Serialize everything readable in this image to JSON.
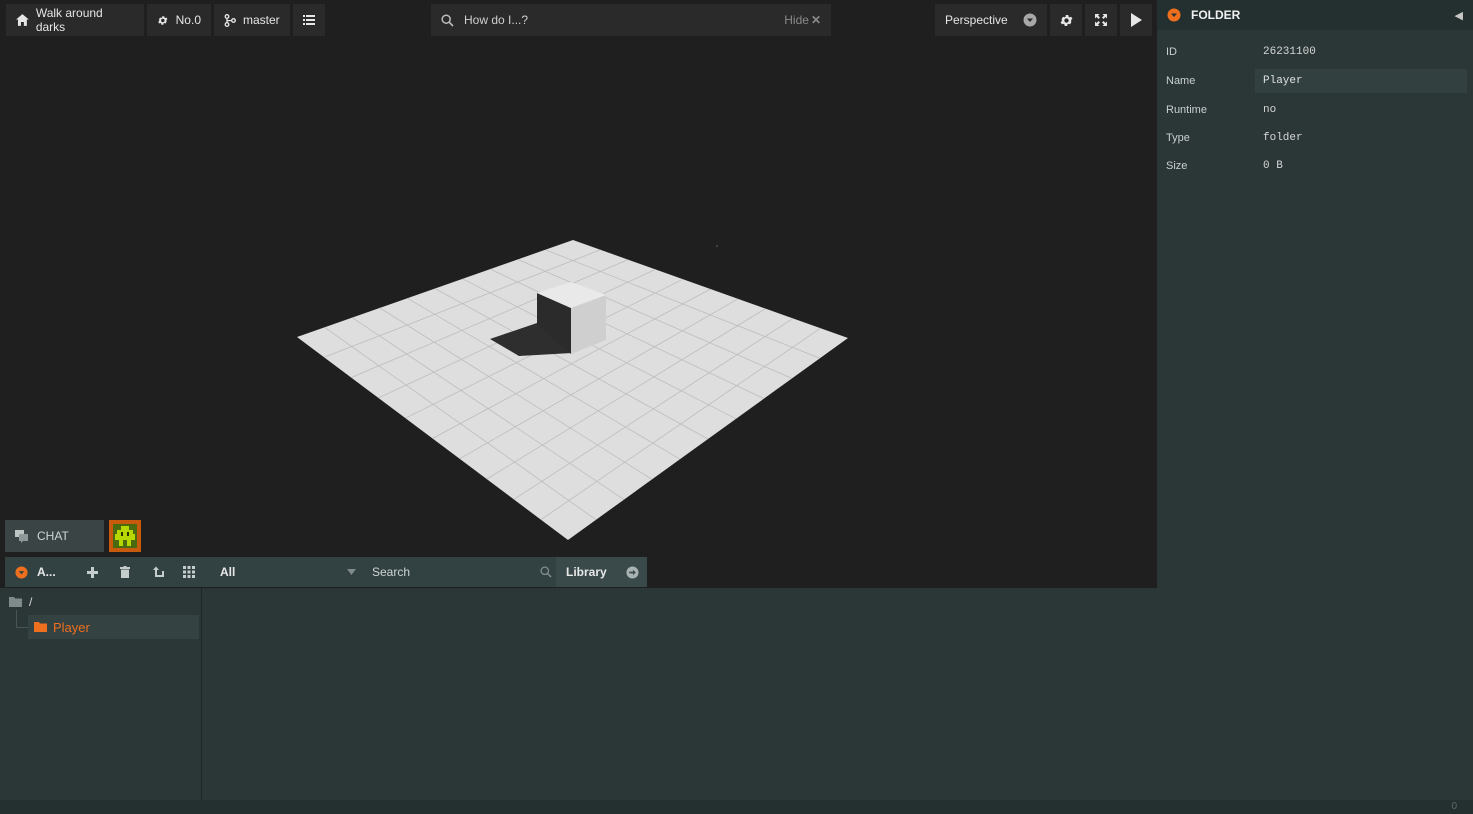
{
  "toolbar": {
    "project_name": "Walk around darks",
    "revision": "No.0",
    "branch": "master",
    "search_placeholder": "How do I...?",
    "hide_label": "Hide",
    "camera_mode": "Perspective"
  },
  "inspector": {
    "title": "FOLDER",
    "rows": [
      {
        "label": "ID",
        "value": "26231100"
      },
      {
        "label": "Name",
        "value": "Player"
      },
      {
        "label": "Runtime",
        "value": "no"
      },
      {
        "label": "Type",
        "value": "folder"
      },
      {
        "label": "Size",
        "value": "0 B"
      }
    ]
  },
  "chat": {
    "label": "CHAT"
  },
  "assets": {
    "panel_title": "A...",
    "filter_value": "All",
    "search_placeholder": "Search",
    "library_label": "Library",
    "tree": {
      "root_label": "/",
      "items": [
        {
          "label": "Player"
        }
      ]
    }
  },
  "status": {
    "count": "0"
  },
  "colors": {
    "accent": "#ee6f1e",
    "panel_bg": "#2b3636",
    "viewport_bg": "#1f1f1f",
    "avatar_bg": "#c85a0e",
    "avatar_face": "#b8d600"
  }
}
